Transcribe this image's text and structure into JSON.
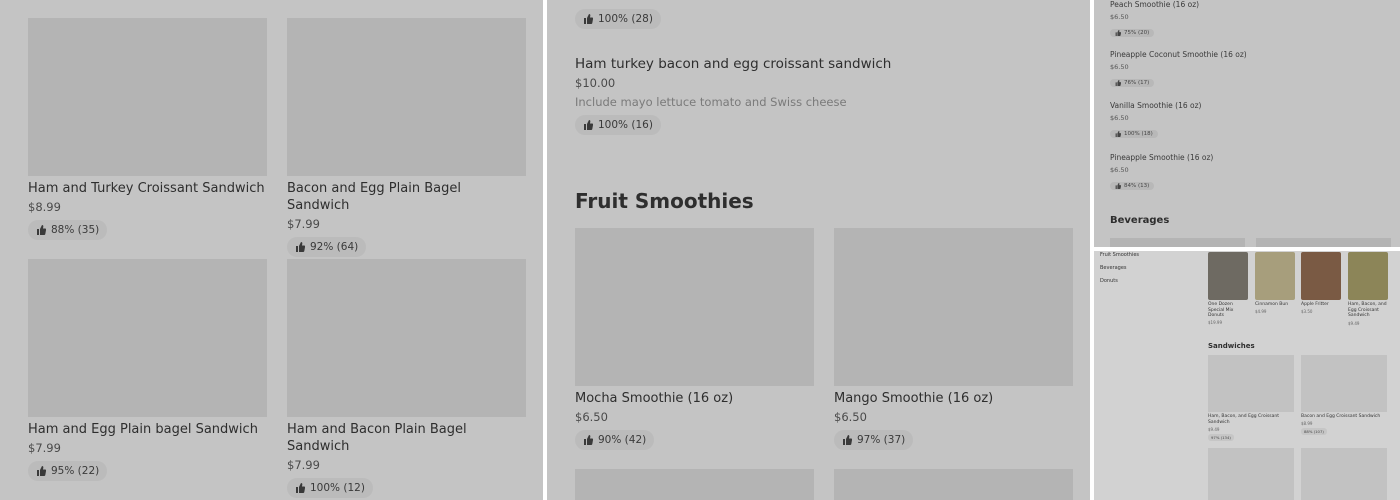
{
  "panel1": {
    "cards": [
      {
        "name": "Ham and Turkey Croissant Sandwich",
        "price": "$8.99",
        "rating": "88% (35)"
      },
      {
        "name": "Bacon and Egg Plain Bagel Sandwich",
        "price": "$7.99",
        "rating": "92% (64)"
      },
      {
        "name": "Ham and Egg Plain bagel Sandwich",
        "price": "$7.99",
        "rating": "95% (22)"
      },
      {
        "name": "Ham and Bacon Plain Bagel Sandwich",
        "price": "$7.99",
        "rating": "100% (12)"
      }
    ]
  },
  "panel2": {
    "top_rating": "100% (28)",
    "item": {
      "name": "Ham turkey bacon and egg croissant sandwich",
      "price": "$10.00",
      "description": "Include mayo lettuce tomato and Swiss cheese",
      "rating": "100% (16)"
    },
    "section_title": "Fruit Smoothies",
    "cards": [
      {
        "name": "Mocha Smoothie (16 oz)",
        "price": "$6.50",
        "rating": "90% (42)"
      },
      {
        "name": "Mango Smoothie (16 oz)",
        "price": "$6.50",
        "rating": "97% (37)"
      }
    ]
  },
  "panel3": {
    "items": [
      {
        "name": "Peach Smoothie (16 oz)",
        "price": "$6.50",
        "rating": "75% (20)"
      },
      {
        "name": "Pineapple Coconut Smoothie (16 oz)",
        "price": "$6.50",
        "rating": "76% (17)"
      },
      {
        "name": "Vanilla Smoothie (16 oz)",
        "price": "$6.50",
        "rating": "100% (18)"
      },
      {
        "name": "Pineapple Smoothie (16 oz)",
        "price": "$6.50",
        "rating": "84% (13)"
      }
    ],
    "section_title": "Beverages"
  },
  "panel4": {
    "nav": [
      "Fruit Smoothies",
      "Beverages",
      "Donuts"
    ],
    "featured": [
      {
        "name": "One Dozen Special Mix Donuts",
        "price": "$19.99",
        "color": "#6e6a62"
      },
      {
        "name": "Cinnamon Bun",
        "price": "$4.99",
        "color": "#a79e7c"
      },
      {
        "name": "Apple Fritter",
        "price": "$3.50",
        "color": "#7a5a44"
      },
      {
        "name": "Ham, Bacon, and Egg Croissant Sandwich",
        "price": "$9.49",
        "color": "#8c8558"
      }
    ],
    "section_title": "Sandwiches",
    "sandwiches": [
      {
        "name": "Ham, Bacon, and Egg Croissant Sandwich",
        "price": "$9.49",
        "rating": "97% (134)"
      },
      {
        "name": "Bacon and Egg Croissant Sandwich",
        "price": "$8.99",
        "rating": "88% (107)"
      }
    ]
  }
}
